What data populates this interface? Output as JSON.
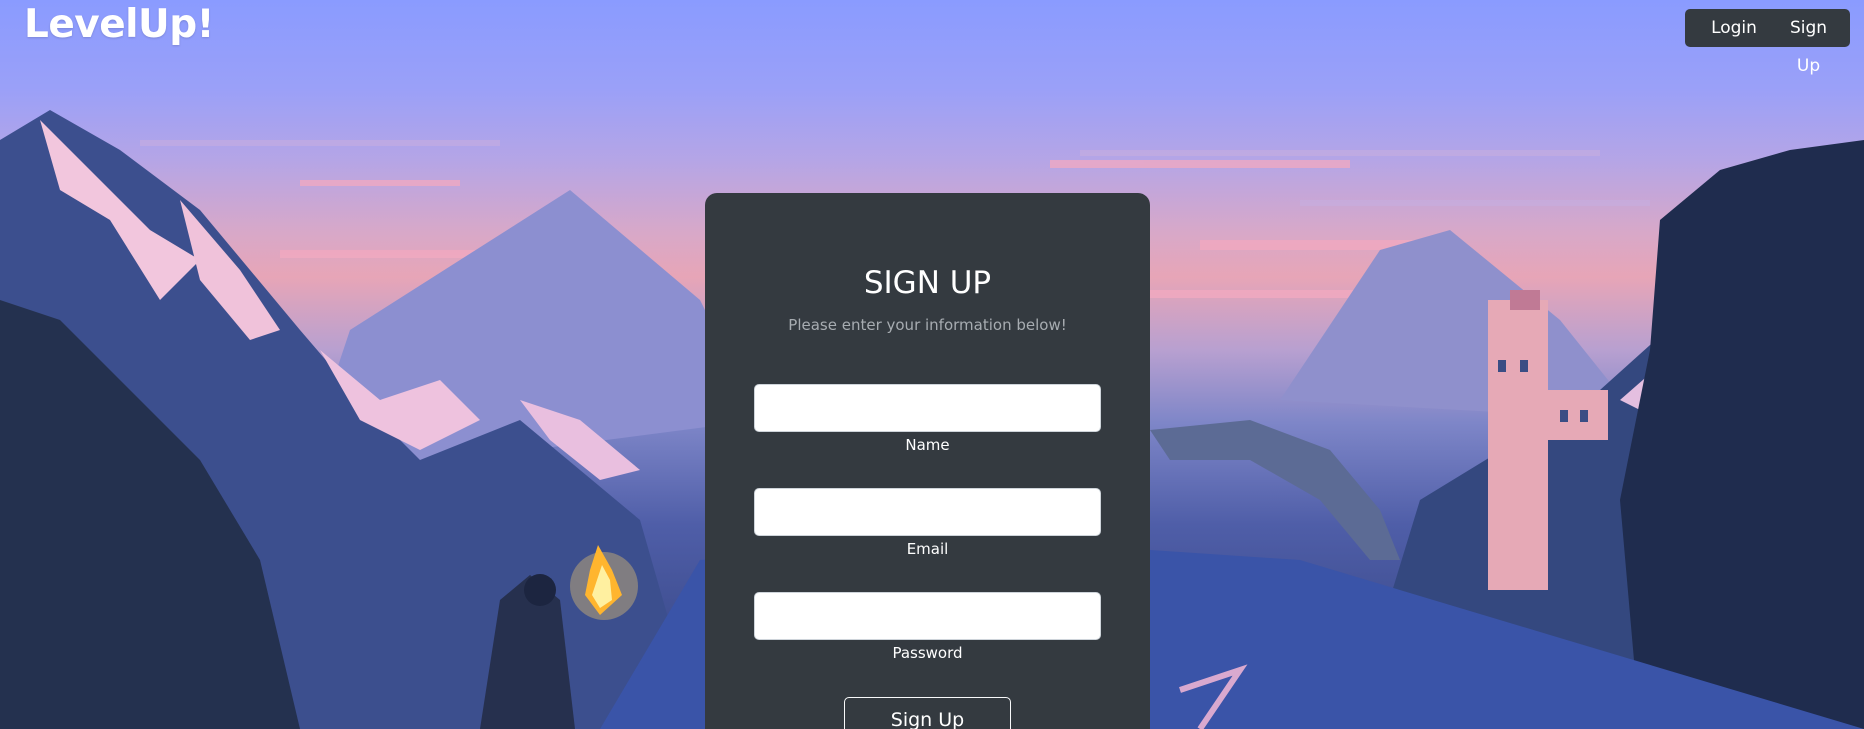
{
  "brand": {
    "name": "LevelUp!"
  },
  "nav": {
    "login_label": "Login",
    "signup_label": "Sign Up"
  },
  "form": {
    "title": "SIGN UP",
    "subtitle": "Please enter your information below!",
    "fields": [
      {
        "label": "Name",
        "value": "",
        "placeholder": ""
      },
      {
        "label": "Email",
        "value": "",
        "placeholder": ""
      },
      {
        "label": "Password",
        "value": "",
        "placeholder": ""
      }
    ],
    "submit_label": "Sign Up"
  },
  "colors": {
    "card": "#343a40",
    "nav_button": "#343a40",
    "sky_top": "#8a9bff",
    "sky_pink": "#e7a5b7",
    "mountain_dark": "#2f3f7a"
  },
  "background": {
    "image_name": "pixel-art-mountain-landscape"
  }
}
